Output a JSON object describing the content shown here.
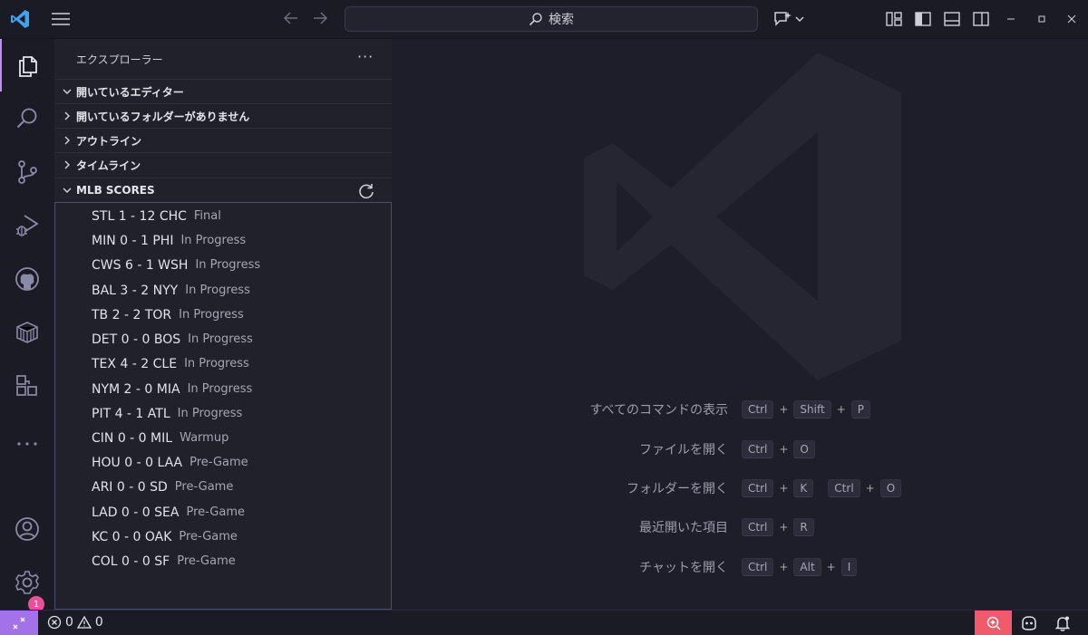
{
  "colors": {
    "accent": "#a372e8",
    "active_indicator": "#c18dff",
    "badge": "#e8509a",
    "zoom": "#f05a6a"
  },
  "titlebar": {
    "search_text": "検索",
    "icons": [
      "vscode-logo-icon",
      "menu-icon",
      "arrow-left-icon",
      "arrow-right-icon",
      "search-icon",
      "copilot-icon",
      "chevron-down-icon",
      "customize-layout-icon",
      "toggle-primary-sidebar-icon",
      "toggle-panel-icon",
      "toggle-secondary-sidebar-icon",
      "minimize-icon",
      "maximize-icon",
      "close-icon"
    ]
  },
  "activitybar": {
    "items": [
      "explorer-icon",
      "search-icon",
      "source-control-icon",
      "run-debug-icon",
      "github-icon",
      "containers-icon",
      "extensions-icon",
      "more-icon",
      "account-icon",
      "manage-gear-icon"
    ],
    "manage_badge": "1"
  },
  "sidebar": {
    "title": "エクスプローラー",
    "more": "···",
    "sections": [
      {
        "label": "開いているエディター",
        "expanded": true
      },
      {
        "label": "開いているフォルダーがありません",
        "expanded": false
      },
      {
        "label": "アウトライン",
        "expanded": false
      },
      {
        "label": "タイムライン",
        "expanded": false
      },
      {
        "label": "MLB SCORES",
        "expanded": true
      }
    ],
    "scores": [
      {
        "score": "STL 1 - 12 CHC",
        "status": "Final"
      },
      {
        "score": "MIN 0 - 1 PHI",
        "status": "In Progress"
      },
      {
        "score": "CWS 6 - 1 WSH",
        "status": "In Progress"
      },
      {
        "score": "BAL 3 - 2 NYY",
        "status": "In Progress"
      },
      {
        "score": "TB 2 - 2 TOR",
        "status": "In Progress"
      },
      {
        "score": "DET 0 - 0 BOS",
        "status": "In Progress"
      },
      {
        "score": "TEX 4 - 2 CLE",
        "status": "In Progress"
      },
      {
        "score": "NYM 2 - 0 MIA",
        "status": "In Progress"
      },
      {
        "score": "PIT 4 - 1 ATL",
        "status": "In Progress"
      },
      {
        "score": "CIN 0 - 0 MIL",
        "status": "Warmup"
      },
      {
        "score": "HOU 0 - 0 LAA",
        "status": "Pre-Game"
      },
      {
        "score": "ARI 0 - 0 SD",
        "status": "Pre-Game"
      },
      {
        "score": "LAD 0 - 0 SEA",
        "status": "Pre-Game"
      },
      {
        "score": "KC 0 - 0 OAK",
        "status": "Pre-Game"
      },
      {
        "score": "COL 0 - 0 SF",
        "status": "Pre-Game"
      }
    ]
  },
  "editor": {
    "shortcuts": [
      {
        "label": "すべてのコマンドの表示",
        "keys": [
          [
            "Ctrl",
            "Shift",
            "P"
          ]
        ]
      },
      {
        "label": "ファイルを開く",
        "keys": [
          [
            "Ctrl",
            "O"
          ]
        ]
      },
      {
        "label": "フォルダーを開く",
        "keys": [
          [
            "Ctrl",
            "K"
          ],
          [
            "Ctrl",
            "O"
          ]
        ]
      },
      {
        "label": "最近開いた項目",
        "keys": [
          [
            "Ctrl",
            "R"
          ]
        ]
      },
      {
        "label": "チャットを開く",
        "keys": [
          [
            "Ctrl",
            "Alt",
            "I"
          ]
        ]
      }
    ]
  },
  "statusbar": {
    "errors": "0",
    "warnings": "0"
  }
}
